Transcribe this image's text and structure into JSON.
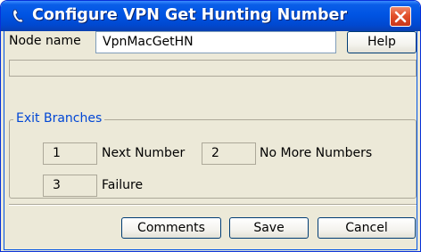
{
  "window": {
    "title": "Configure VPN Get Hunting Number"
  },
  "node": {
    "label": "Node name",
    "value": "VpnMacGetHN",
    "help_label": "Help"
  },
  "exit_branches": {
    "title": "Exit Branches",
    "items": [
      {
        "number": "1",
        "label": "Next Number"
      },
      {
        "number": "2",
        "label": "No More Numbers"
      },
      {
        "number": "3",
        "label": "Failure"
      }
    ]
  },
  "buttons": {
    "comments": "Comments",
    "save": "Save",
    "cancel": "Cancel"
  },
  "colors": {
    "titlebar": "#0054e3",
    "group_title": "#0046d5",
    "close_button": "#e2502a"
  }
}
